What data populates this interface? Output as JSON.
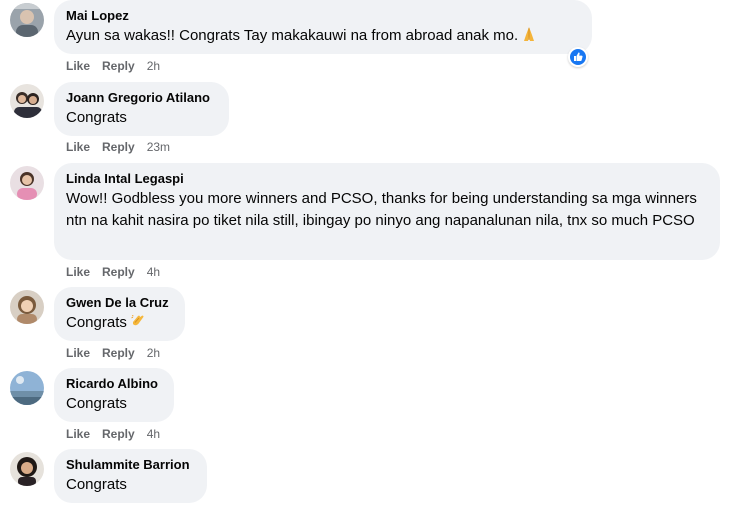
{
  "colors": {
    "bubble_bg": "#f0f2f5",
    "text": "#050505",
    "meta": "#65676b",
    "like_blue": "#1877f2"
  },
  "comments": [
    {
      "author": "Mai Lopez",
      "text": "Ayun sa wakas!! Congrats Tay makakauwi na from abroad anak mo.",
      "emoji": "folded-hands-icon",
      "reaction": "like-reaction-icon",
      "like_label": "Like",
      "reply_label": "Reply",
      "time": "2h"
    },
    {
      "author": "Joann Gregorio Atilano",
      "text": "Congrats",
      "like_label": "Like",
      "reply_label": "Reply",
      "time": "23m"
    },
    {
      "author": "Linda Intal Legaspi",
      "text": "Wow!! Godbless you more winners and PCSO, thanks for being understanding sa mga winners ntn na kahit nasira po tiket nila still, ibingay po ninyo ang napanalunan nila, tnx so much PCSO",
      "like_label": "Like",
      "reply_label": "Reply",
      "time": "4h"
    },
    {
      "author": "Gwen De la Cruz",
      "text": "Congrats",
      "emoji": "clapping-hands-icon",
      "like_label": "Like",
      "reply_label": "Reply",
      "time": "2h"
    },
    {
      "author": "Ricardo Albino",
      "text": "Congrats",
      "like_label": "Like",
      "reply_label": "Reply",
      "time": "4h"
    },
    {
      "author": "Shulammite Barrion",
      "text": "Congrats"
    }
  ]
}
